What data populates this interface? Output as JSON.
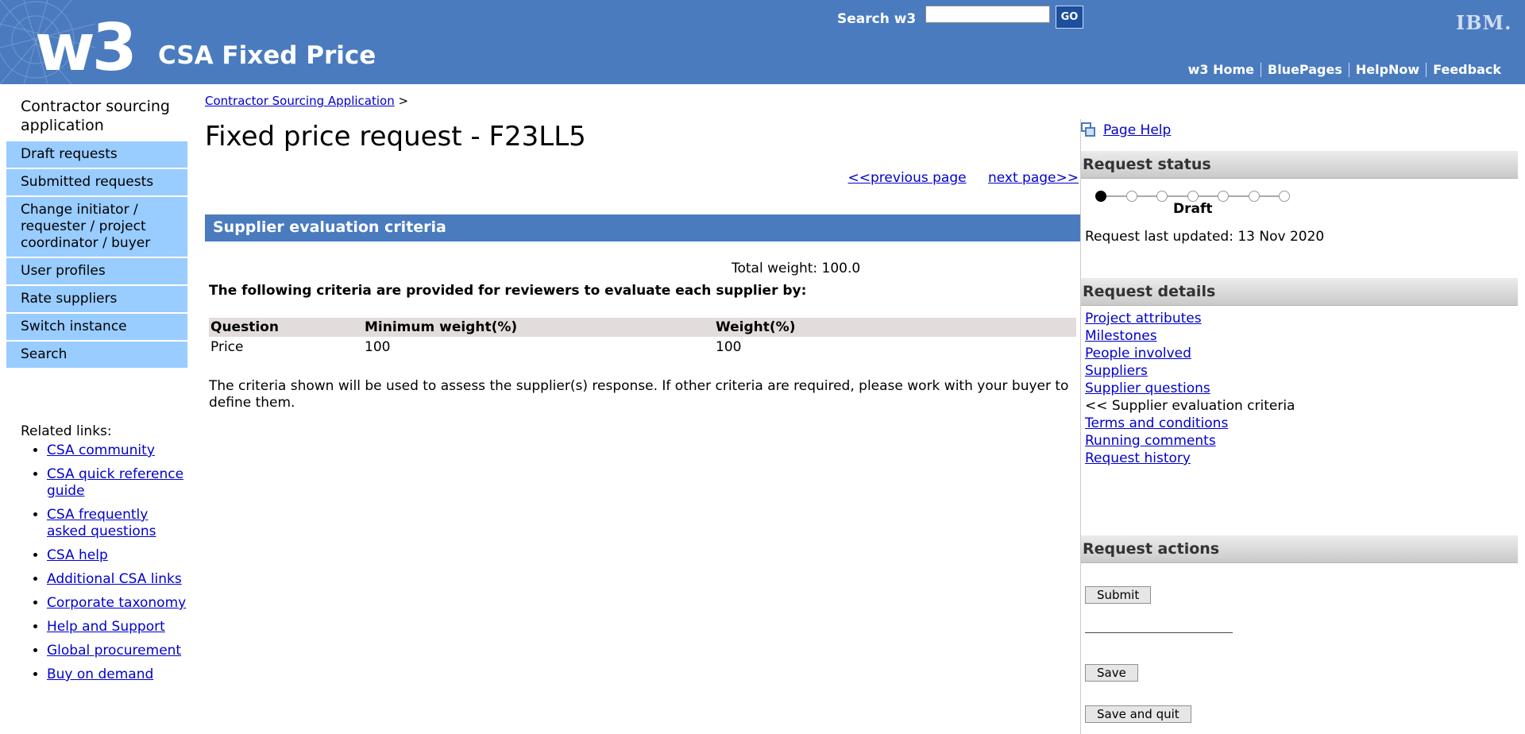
{
  "header": {
    "logo_text": "w3",
    "site_title": "CSA Fixed Price",
    "search_label": "Search w3",
    "search_value": "",
    "go_label": "GO",
    "ibm_logo": "IBM.",
    "links": [
      "w3 Home",
      "BluePages",
      "HelpNow",
      "Feedback"
    ],
    "bg_color": "#4a7bbf"
  },
  "sidebar": {
    "title": "Contractor sourcing application",
    "items": [
      "Draft requests",
      "Submitted requests",
      "Change initiator / requester / project coordinator / buyer",
      "User profiles",
      "Rate suppliers",
      "Switch instance",
      "Search"
    ],
    "item_bg": "#99ccff",
    "related_title": "Related links:",
    "related_links": [
      "CSA community",
      "CSA quick reference guide",
      "CSA frequently asked questions",
      "CSA help",
      "Additional CSA links",
      "Corporate taxonomy",
      "Help and Support",
      "Global procurement",
      "Buy on demand"
    ]
  },
  "main": {
    "breadcrumb_link": "Contractor Sourcing Application",
    "breadcrumb_sep": ">",
    "title": "Fixed price request - F23LL5",
    "prev_page": "<<previous page",
    "next_page": "next page>>",
    "section_title": "Supplier evaluation criteria",
    "total_weight": "Total weight: 100.0",
    "criteria_intro": "The following criteria are provided for reviewers to evaluate each supplier by:",
    "table": {
      "headers": [
        "Question",
        "Minimum weight(%)",
        "Weight(%)"
      ],
      "rows": [
        [
          "Price",
          "100",
          "100"
        ]
      ]
    },
    "note": "The criteria shown will be used to assess the supplier(s) response. If other criteria are required, please work with your buyer to define them."
  },
  "right": {
    "page_help": "Page Help",
    "status_title": "Request status",
    "status_steps_total": 7,
    "status_steps_done": 1,
    "status_label": "Draft",
    "last_updated": "Request last updated: 13 Nov 2020",
    "details_title": "Request details",
    "details": [
      {
        "label": "Project attributes",
        "link": true
      },
      {
        "label": "Milestones",
        "link": true
      },
      {
        "label": "People involved",
        "link": true
      },
      {
        "label": "Suppliers",
        "link": true
      },
      {
        "label": "Supplier questions",
        "link": true
      },
      {
        "label": "<< Supplier evaluation criteria",
        "link": false
      },
      {
        "label": "Terms and conditions",
        "link": true
      },
      {
        "label": "Running comments",
        "link": true
      },
      {
        "label": "Request history",
        "link": true
      }
    ],
    "actions_title": "Request actions",
    "submit_label": "Submit",
    "save_label": "Save",
    "save_quit_label": "Save and quit"
  }
}
